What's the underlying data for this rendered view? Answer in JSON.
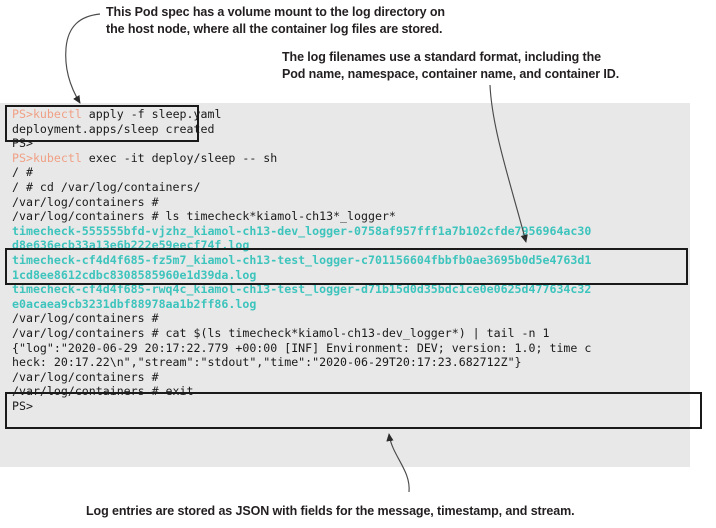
{
  "captions": {
    "top_left": "This Pod spec has a volume mount to the log directory on\nthe host node, where all the container log files are stored.",
    "top_right": "The log filenames use a standard format, including the\nPod name, namespace, container name, and container ID.",
    "bottom": "Log entries are stored as JSON with fields for the message, timestamp, and stream."
  },
  "colors": {
    "terminal_background": "#e8e8e8",
    "page_background": "#ffffff",
    "text": "#1a1a1a",
    "command_highlight": "#f0a085",
    "filename_cyan": "#3dc4bd",
    "box_outline": "#1a1a1a"
  },
  "terminal": {
    "lines": [
      {
        "id": "l01",
        "prompt": "PS>",
        "command": "kubectl",
        "rest": " apply -f sleep.yaml",
        "style": "normal"
      },
      {
        "id": "l02",
        "text": "deployment.apps/sleep created",
        "style": "normal"
      },
      {
        "id": "l03",
        "text": "PS>",
        "style": "normal"
      },
      {
        "id": "l04",
        "prompt": "PS>",
        "command": "kubectl",
        "rest": " exec -it deploy/sleep -- sh",
        "style": "normal"
      },
      {
        "id": "l05",
        "text": "/ #",
        "style": "normal"
      },
      {
        "id": "l06",
        "text": "/ # cd /var/log/containers/",
        "style": "normal"
      },
      {
        "id": "l07",
        "text": "/var/log/containers #",
        "style": "normal"
      },
      {
        "id": "l08",
        "text": "/var/log/containers # ls timecheck*kiamol-ch13*_logger*",
        "style": "normal"
      },
      {
        "id": "l09",
        "text": "timecheck-555555bfd-vjzhz_kiamol-ch13-dev_logger-0758af957fff1a7b102cfde7956964ac30",
        "style": "cyan"
      },
      {
        "id": "l10",
        "text": "d8e636ecb33a13e6b222e59eecf74f.log",
        "style": "cyan"
      },
      {
        "id": "l11",
        "text": "timecheck-cf4d4f685-fz5m7_kiamol-ch13-test_logger-c701156604fbbfb0ae3695b0d5e4763d1",
        "style": "cyan"
      },
      {
        "id": "l12",
        "text": "1cd8ee8612cdbc8308585960e1d39da.log",
        "style": "cyan"
      },
      {
        "id": "l13",
        "text": "timecheck-cf4d4f685-rwq4c_kiamol-ch13-test_logger-d71b15d0d35bdc1ce0e0625d477634c32",
        "style": "cyan"
      },
      {
        "id": "l14",
        "text": "e0acaea9cb3231dbf88978aa1b2ff86.log",
        "style": "cyan"
      },
      {
        "id": "l15",
        "text": "/var/log/containers #",
        "style": "normal"
      },
      {
        "id": "l16",
        "text": "/var/log/containers # cat $(ls timecheck*kiamol-ch13-dev_logger*) | tail -n 1",
        "style": "normal"
      },
      {
        "id": "l17",
        "text": "{\"log\":\"2020-06-29 20:17:22.779 +00:00 [INF] Environment: DEV; version: 1.0; time c",
        "style": "normal"
      },
      {
        "id": "l18",
        "text": "heck: 20:17.22\\n\",\"stream\":\"stdout\",\"time\":\"2020-06-29T20:17:23.682712Z\"}",
        "style": "normal"
      },
      {
        "id": "l19",
        "text": "/var/log/containers #",
        "style": "normal"
      },
      {
        "id": "l20",
        "text": "/var/log/containers # exit",
        "style": "normal"
      },
      {
        "id": "l21",
        "text": "PS>",
        "style": "normal"
      }
    ]
  },
  "highlight_boxes": [
    {
      "id": "box-apply",
      "name": "apply-command-highlight"
    },
    {
      "id": "box-lognames",
      "name": "log-filename-highlight"
    },
    {
      "id": "box-json",
      "name": "json-log-entry-highlight"
    }
  ],
  "arrows": [
    {
      "id": "arrow-1",
      "name": "arrow-to-apply-box"
    },
    {
      "id": "arrow-2",
      "name": "arrow-to-log-filename-box"
    },
    {
      "id": "arrow-3",
      "name": "arrow-to-json-box"
    }
  ]
}
